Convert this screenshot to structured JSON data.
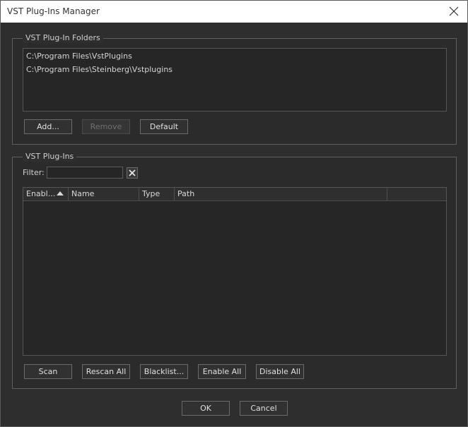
{
  "window": {
    "title": "VST Plug-Ins Manager"
  },
  "folders": {
    "group_label": "VST Plug-In Folders",
    "items": [
      "C:\\Program Files\\VstPlugins",
      "C:\\Program Files\\Steinberg\\Vstplugins"
    ],
    "add_label": "Add...",
    "remove_label": "Remove",
    "default_label": "Default"
  },
  "plugins": {
    "group_label": "VST Plug-Ins",
    "filter_label": "Filter:",
    "filter_value": "",
    "columns": [
      "Enabl...",
      "Name",
      "Type",
      "Path"
    ],
    "rows": [],
    "scan_label": "Scan",
    "rescan_all_label": "Rescan All",
    "blacklist_label": "Blacklist...",
    "enable_all_label": "Enable All",
    "disable_all_label": "Disable All"
  },
  "dialog": {
    "ok_label": "OK",
    "cancel_label": "Cancel"
  },
  "icons": {
    "close": "close-icon",
    "clear_filter": "clear-filter-icon",
    "sort": "sort-ascending-icon"
  },
  "colors": {
    "background": "#2e2e2e",
    "panel": "#262626",
    "border": "#5f5f5f",
    "text": "#d6d6d6"
  }
}
